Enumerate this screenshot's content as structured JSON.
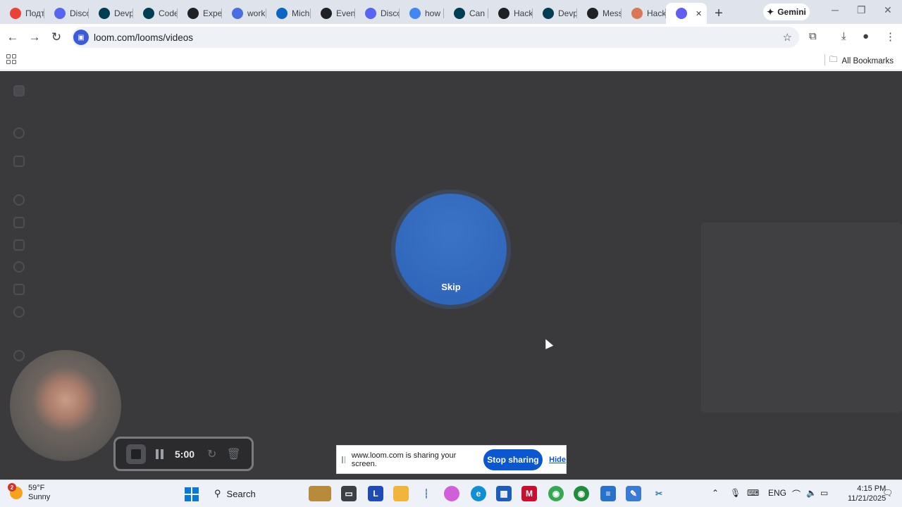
{
  "browser": {
    "tabs": [
      {
        "title": "Подт",
        "icon": "gmail-icon",
        "color": "#ea4335"
      },
      {
        "title": "Disco",
        "icon": "discord-icon",
        "color": "#5865f2"
      },
      {
        "title": "Devp",
        "icon": "devpost-icon",
        "color": "#003e54"
      },
      {
        "title": "Code",
        "icon": "devpost-icon",
        "color": "#003e54"
      },
      {
        "title": "Expe",
        "icon": "r-icon",
        "color": "#202124"
      },
      {
        "title": "work",
        "icon": "m-icon",
        "color": "#4a6ee0"
      },
      {
        "title": "Mich",
        "icon": "linkedin-icon",
        "color": "#0a66c2"
      },
      {
        "title": "Event",
        "icon": "sparkle-icon",
        "color": "#202124"
      },
      {
        "title": "Disco",
        "icon": "discord-icon",
        "color": "#5865f2"
      },
      {
        "title": "how",
        "icon": "google-icon",
        "color": "#4285f4"
      },
      {
        "title": "Can I",
        "icon": "devpost-icon",
        "color": "#003e54"
      },
      {
        "title": "Hack",
        "icon": "chatgpt-icon",
        "color": "#202124"
      },
      {
        "title": "Devp",
        "icon": "devpost-icon",
        "color": "#003e54"
      },
      {
        "title": "Mess",
        "icon": "chatgpt-icon",
        "color": "#202124"
      },
      {
        "title": "Hack",
        "icon": "claude-icon",
        "color": "#d97757"
      },
      {
        "title": "",
        "icon": "loom-icon",
        "color": "#625df5",
        "active": true
      }
    ],
    "gemini_label": "Gemini",
    "url": "loom.com/looms/videos",
    "all_bookmarks": "All Bookmarks"
  },
  "loom": {
    "skip_label": "Skip",
    "recording_time": "5:00"
  },
  "share_banner": {
    "text": "www.loom.com is sharing your screen.",
    "stop_label": "Stop sharing",
    "hide_label": "Hide"
  },
  "taskbar": {
    "weather_temp": "59°F",
    "weather_desc": "Sunny",
    "weather_badge": "2",
    "search_label": "Search",
    "lang": "ENG",
    "time": "4:15 PM",
    "date": "11/21/2025"
  },
  "colors": {
    "accent": "#0b57d0",
    "loom_blue": "#2c62b8",
    "page_dim": "#3a3a3c"
  }
}
